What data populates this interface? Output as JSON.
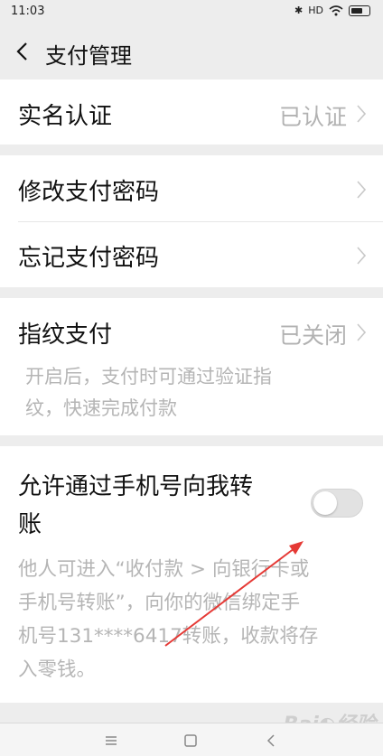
{
  "status_bar": {
    "time": "11:03",
    "signal_label": "HD"
  },
  "header": {
    "title": "支付管理",
    "back_icon": "chevron-left-icon"
  },
  "settings": {
    "real_name": {
      "label": "实名认证",
      "value": "已认证"
    },
    "change_password": {
      "label": "修改支付密码"
    },
    "forgot_password": {
      "label": "忘记支付密码"
    },
    "fingerprint": {
      "label": "指纹支付",
      "value": "已关闭",
      "desc_line1": "开启后，支付时可通过验证指",
      "desc_line2": "纹，快速完成付款"
    },
    "phone_transfer": {
      "label_line1": "允许通过手机号向我转",
      "label_line2": "账",
      "enabled": false,
      "desc_line1": "他人可进入“收付款 > 向银行卡或",
      "desc_line2": "手机号转账”，向你的微信绑定手",
      "desc_line3": "机号131****6417转账，收款将存",
      "desc_line4": "入零钱。"
    }
  },
  "nav_buttons": [
    "menu-icon",
    "home-icon",
    "back-icon"
  ],
  "colors": {
    "background": "#ededed",
    "card": "#ffffff",
    "secondary_text": "#b2b2b2",
    "annotation_arrow": "#e53935"
  }
}
